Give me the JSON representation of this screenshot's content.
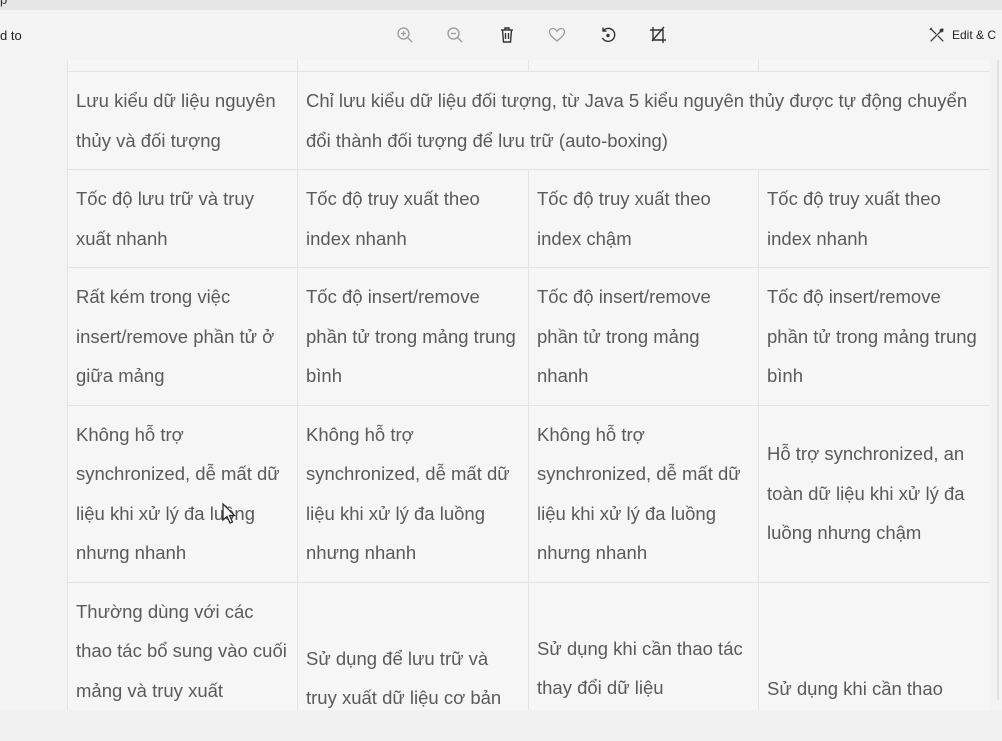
{
  "window": {
    "title_fragment": "p"
  },
  "toolbar": {
    "left_label": "d to",
    "edit_label": "Edit & C",
    "tools": [
      "zoom-in-icon",
      "zoom-out-icon",
      "delete-icon",
      "favorite-icon",
      "rotate-icon",
      "crop-icon"
    ]
  },
  "table": {
    "rows": [
      [
        "Lưu kiểu dữ liệu nguyên thủy và đối tượng",
        "Chỉ lưu kiểu dữ liệu đối tượng, từ Java 5 kiểu nguyên thủy được tự động chuyển đổi thành đối tượng để lưu trữ (auto-boxing)"
      ],
      [
        "Tốc độ lưu trữ và truy xuất nhanh",
        "Tốc độ truy xuất theo index nhanh",
        "Tốc độ truy xuất theo index chậm",
        "Tốc độ truy xuất theo index nhanh"
      ],
      [
        "Rất kém trong việc insert/remove phần tử ở giữa mảng",
        "Tốc độ insert/remove phần tử trong mảng trung bình",
        "Tốc độ insert/remove phần tử trong mảng nhanh",
        "Tốc độ insert/remove phần tử trong mảng trung bình"
      ],
      [
        "Không hỗ trợ synchronized, dễ mất dữ liệu khi xử lý đa luồng nhưng nhanh",
        "Không hỗ trợ synchronized, dễ mất dữ liệu khi xử lý đa luồng nhưng nhanh",
        "Không hỗ trợ synchronized, dễ mất dữ liệu khi xử lý đa luồng nhưng nhanh",
        "Hỗ trợ synchronized, an toàn dữ liệu khi xử lý đa luồng nhưng chậm"
      ],
      [
        "Thường dùng với các thao tác bổ sung vào cuối mảng và truy xuất",
        "Sử dụng để lưu trữ và truy xuất dữ liệu cơ bản",
        "Sử dụng khi cần thao tác thay đổi dữ liệu",
        "Sử dụng khi cần thao"
      ]
    ]
  }
}
